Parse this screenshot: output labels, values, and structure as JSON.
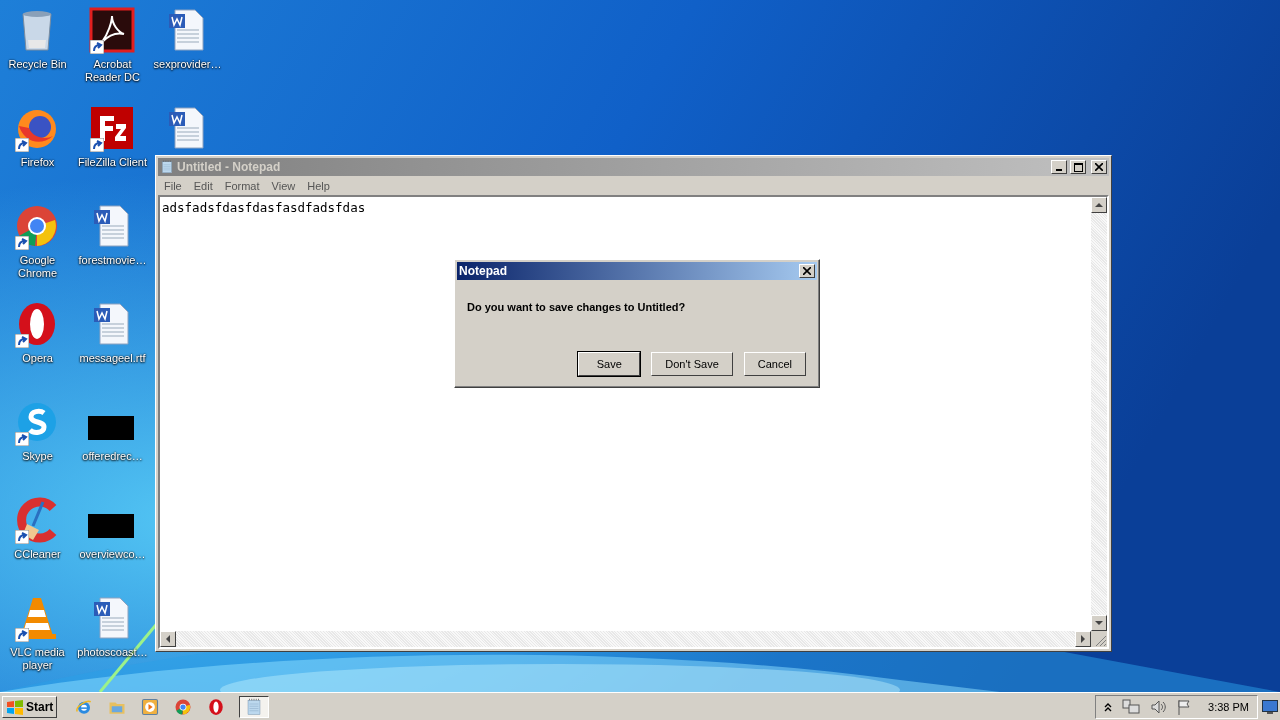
{
  "desktop": {
    "icons": [
      {
        "label": "Recycle Bin",
        "kind": "recycle",
        "shortcut": false
      },
      {
        "label": "Firefox",
        "kind": "firefox",
        "shortcut": true
      },
      {
        "label": "Google Chrome",
        "kind": "chrome",
        "shortcut": true
      },
      {
        "label": "Opera",
        "kind": "opera",
        "shortcut": true
      },
      {
        "label": "Skype",
        "kind": "skype",
        "shortcut": true
      },
      {
        "label": "CCleaner",
        "kind": "ccleaner",
        "shortcut": true
      },
      {
        "label": "VLC media player",
        "kind": "vlc",
        "shortcut": true
      },
      {
        "label": "Acrobat Reader DC",
        "kind": "acrobat",
        "shortcut": true
      },
      {
        "label": "FileZilla Client",
        "kind": "filezilla",
        "shortcut": true
      },
      {
        "label": "forestmovie…",
        "kind": "word",
        "shortcut": false
      },
      {
        "label": "messageel.rtf",
        "kind": "word",
        "shortcut": false
      },
      {
        "label": "offeredrec…",
        "kind": "redacted",
        "shortcut": false
      },
      {
        "label": "overviewco…",
        "kind": "redacted",
        "shortcut": false
      },
      {
        "label": "photoscoast…",
        "kind": "word",
        "shortcut": false
      },
      {
        "label": "sexprovider…",
        "kind": "word",
        "shortcut": false
      },
      {
        "kind": "word",
        "shortcut": false
      }
    ]
  },
  "notepad": {
    "title": "Untitled - Notepad",
    "active": false,
    "menu": [
      "File",
      "Edit",
      "Format",
      "View",
      "Help"
    ],
    "text": "adsfadsfdasfdasfasdfadsfdas"
  },
  "dialog": {
    "title": "Notepad",
    "active": true,
    "message": "Do you want to save changes to Untitled?",
    "buttons": [
      {
        "label": "Save",
        "default": true
      },
      {
        "label": "Don't Save",
        "default": false
      },
      {
        "label": "Cancel",
        "default": false
      }
    ]
  },
  "taskbar": {
    "start": "Start",
    "apps": [
      {
        "kind": "ie",
        "active": false
      },
      {
        "kind": "explorer",
        "active": false
      },
      {
        "kind": "media",
        "active": false
      },
      {
        "kind": "chrome",
        "active": false
      },
      {
        "kind": "opera",
        "active": false
      },
      {
        "kind": "notepad",
        "active": true
      }
    ],
    "clock": "3:38 PM"
  }
}
